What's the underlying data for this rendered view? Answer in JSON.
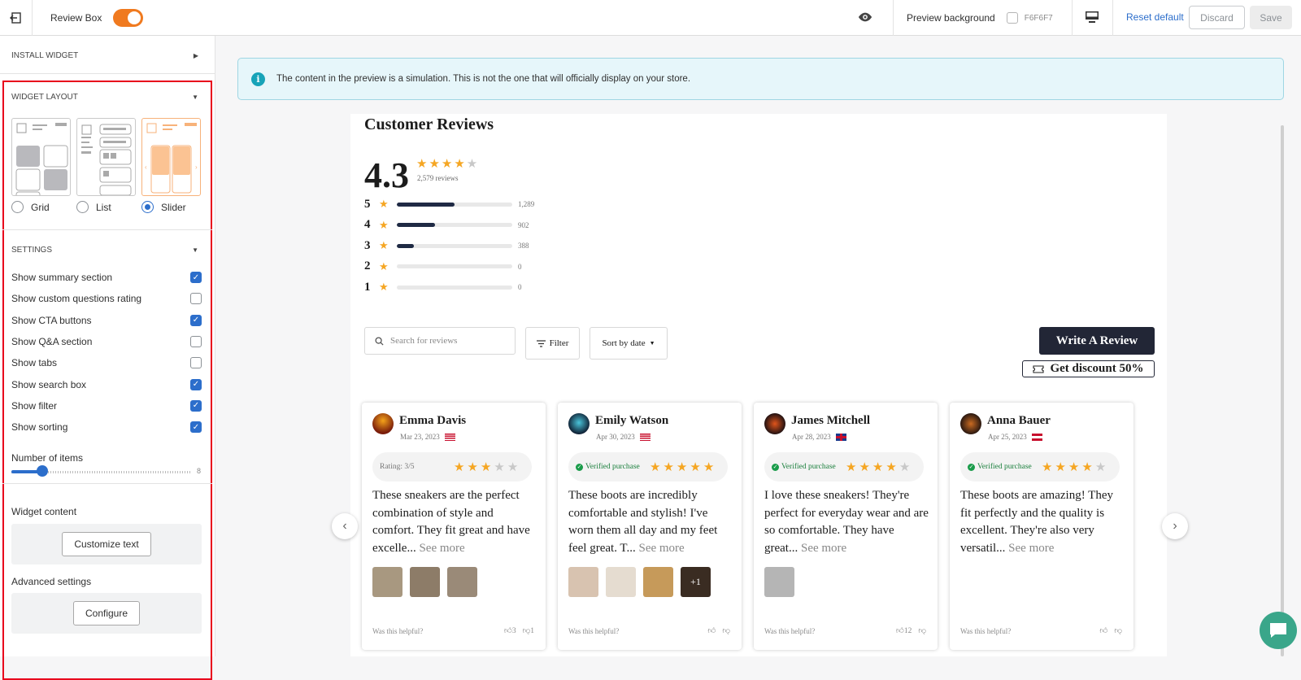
{
  "topbar": {
    "title": "Review Box",
    "preview_bg_label": "Preview background",
    "preview_bg_hex": "F6F6F7",
    "reset_label": "Reset default",
    "discard_label": "Discard",
    "save_label": "Save"
  },
  "sidebar": {
    "install_label": "INSTALL WIDGET",
    "layout_label": "WIDGET LAYOUT",
    "layouts": [
      "Grid",
      "List",
      "Slider"
    ],
    "selected_layout": "Slider",
    "settings_label": "SETTINGS",
    "settings": [
      {
        "label": "Show summary section",
        "checked": true
      },
      {
        "label": "Show custom questions rating",
        "checked": false
      },
      {
        "label": "Show CTA buttons",
        "checked": true
      },
      {
        "label": "Show Q&A section",
        "checked": false
      },
      {
        "label": "Show tabs",
        "checked": false
      },
      {
        "label": "Show search box",
        "checked": true
      },
      {
        "label": "Show filter",
        "checked": true
      },
      {
        "label": "Show sorting",
        "checked": true
      }
    ],
    "items_label": "Number of items",
    "items_value": "8",
    "content_label": "Widget content",
    "customize_label": "Customize text",
    "advanced_label": "Advanced settings",
    "configure_label": "Configure"
  },
  "info_text": "The content in the preview is a simulation. This is not the one that will officially display on your store.",
  "widget": {
    "title": "Customer Reviews",
    "average": "4.3",
    "review_count": "2,579 reviews",
    "breakdown": [
      {
        "star": "5",
        "count": "1,289",
        "fraction": 0.5
      },
      {
        "star": "4",
        "count": "902",
        "fraction": 0.33
      },
      {
        "star": "3",
        "count": "388",
        "fraction": 0.15
      },
      {
        "star": "2",
        "count": "0",
        "fraction": 0
      },
      {
        "star": "1",
        "count": "0",
        "fraction": 0
      }
    ],
    "search_placeholder": "Search for reviews",
    "filter_label": "Filter",
    "sort_label": "Sort by date",
    "write_label": "Write A Review",
    "discount_label": "Get discount 50%",
    "helpful_label": "Was this helpful?",
    "see_more": "See more",
    "reviews": [
      {
        "name": "Emma Davis",
        "date": "Mar 23, 2023",
        "pill": "Rating: 3/5",
        "rating": 3,
        "body": "These sneakers are the perfect combination of style and comfort. They fit great and have excelle...",
        "up": "3",
        "down": "1",
        "extra_photos": ""
      },
      {
        "name": "Emily Watson",
        "date": "Apr 30, 2023",
        "pill": "Verified purchase",
        "rating": 5,
        "body": "These boots are incredibly comfortable and stylish! I've worn them all day and my feet feel great. T...",
        "up": "",
        "down": "",
        "extra_photos": "+1"
      },
      {
        "name": "James Mitchell",
        "date": "Apr 28, 2023",
        "pill": "Verified purchase",
        "rating": 4,
        "body": "I love these sneakers! They're perfect for everyday wear and are so comfortable. They have great...",
        "up": "12",
        "down": "",
        "extra_photos": ""
      },
      {
        "name": "Anna Bauer",
        "date": "Apr 25, 2023",
        "pill": "Verified purchase",
        "rating": 4,
        "body": "These boots are amazing! They fit perfectly and the quality is excellent. They're also very versatil...",
        "up": "",
        "down": "",
        "extra_photos": ""
      }
    ]
  },
  "colors": {
    "accent": "#2c6ecb",
    "toggle": "#f07a1f",
    "star": "#f5a623",
    "highlight": "#e8001c",
    "dark_button": "#222636"
  }
}
